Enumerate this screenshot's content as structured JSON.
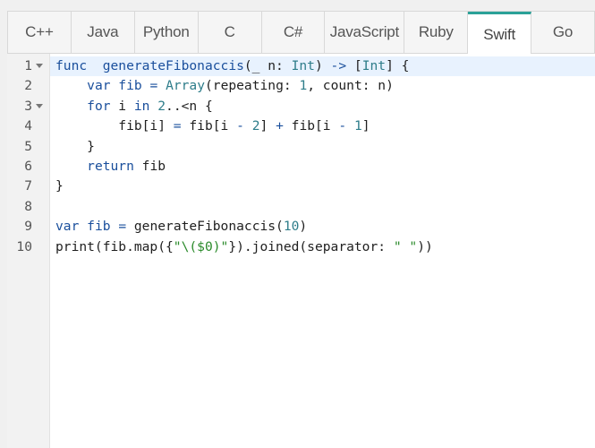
{
  "tabs": [
    {
      "label": "C++",
      "active": false
    },
    {
      "label": "Java",
      "active": false
    },
    {
      "label": "Python",
      "active": false
    },
    {
      "label": "C",
      "active": false
    },
    {
      "label": "C#",
      "active": false
    },
    {
      "label": "JavaScript",
      "active": false
    },
    {
      "label": "Ruby",
      "active": false
    },
    {
      "label": "Swift",
      "active": true
    },
    {
      "label": "Go",
      "active": false
    }
  ],
  "editor": {
    "active_line": 1,
    "fold_markers": [
      1,
      3
    ],
    "lines": [
      {
        "n": "1",
        "tokens": [
          [
            "kw",
            "func"
          ],
          [
            "",
            "  "
          ],
          [
            "fn",
            "generateFibonaccis"
          ],
          [
            "",
            "(_ n: "
          ],
          [
            "ty",
            "Int"
          ],
          [
            "",
            ") "
          ],
          [
            "op",
            "->"
          ],
          [
            "",
            " ["
          ],
          [
            "ty",
            "Int"
          ],
          [
            "",
            "] {"
          ]
        ]
      },
      {
        "n": "2",
        "tokens": [
          [
            "",
            "    "
          ],
          [
            "kw",
            "var"
          ],
          [
            "",
            ""
          ],
          [
            "fn",
            " fib"
          ],
          [
            "",
            " "
          ],
          [
            "op",
            "="
          ],
          [
            "",
            " "
          ],
          [
            "ty",
            "Array"
          ],
          [
            "",
            "(repeating: "
          ],
          [
            "num",
            "1"
          ],
          [
            "",
            ", count: n)"
          ]
        ]
      },
      {
        "n": "3",
        "tokens": [
          [
            "",
            "    "
          ],
          [
            "kw",
            "for"
          ],
          [
            "",
            " i "
          ],
          [
            "kw",
            "in"
          ],
          [
            "",
            " "
          ],
          [
            "num",
            "2"
          ],
          [
            "",
            "..<n {"
          ]
        ]
      },
      {
        "n": "4",
        "tokens": [
          [
            "",
            "        fib[i] "
          ],
          [
            "op",
            "="
          ],
          [
            "",
            " fib[i "
          ],
          [
            "op",
            "-"
          ],
          [
            "",
            " "
          ],
          [
            "num",
            "2"
          ],
          [
            "",
            "] "
          ],
          [
            "op",
            "+"
          ],
          [
            "",
            " fib[i "
          ],
          [
            "op",
            "-"
          ],
          [
            "",
            " "
          ],
          [
            "num",
            "1"
          ],
          [
            "",
            "]"
          ]
        ]
      },
      {
        "n": "5",
        "tokens": [
          [
            "",
            "    }"
          ]
        ]
      },
      {
        "n": "6",
        "tokens": [
          [
            "",
            "    "
          ],
          [
            "kw",
            "return"
          ],
          [
            "",
            " fib"
          ]
        ]
      },
      {
        "n": "7",
        "tokens": [
          [
            "",
            "}"
          ]
        ]
      },
      {
        "n": "8",
        "tokens": []
      },
      {
        "n": "9",
        "tokens": [
          [
            "kw",
            "var"
          ],
          [
            "",
            " "
          ],
          [
            "fn",
            "fib"
          ],
          [
            "",
            " "
          ],
          [
            "op",
            "="
          ],
          [
            "",
            " generateFibonaccis("
          ],
          [
            "num",
            "10"
          ],
          [
            "",
            ")"
          ]
        ]
      },
      {
        "n": "10",
        "tokens": [
          [
            "",
            "print(fib.map({"
          ],
          [
            "str",
            "\"\\($0)\""
          ],
          [
            "",
            "}).joined(separator: "
          ],
          [
            "str",
            "\" \""
          ],
          [
            "",
            "))"
          ]
        ]
      }
    ]
  },
  "colors": {
    "accent": "#2aa198",
    "active_line_bg": "#e8f2fe",
    "keyword": "#1a4f9c",
    "type": "#2e7d8a",
    "string": "#2a8a2a"
  }
}
